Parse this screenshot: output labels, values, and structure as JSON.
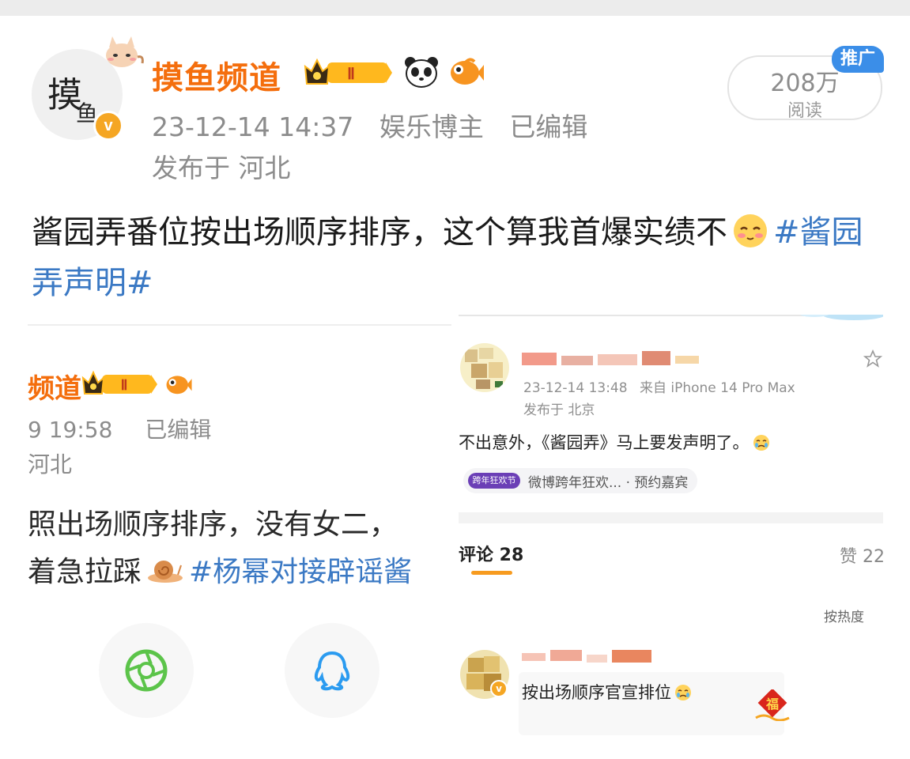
{
  "post": {
    "username": "摸鱼频道",
    "level_badge": "Ⅱ",
    "avatar_calligraphy": "摸",
    "avatar_calligraphy_2": "鱼",
    "verified_mark": "v",
    "timestamp": "23-12-14 14:37",
    "category": "娱乐博主",
    "edited": "已编辑",
    "location": "发布于 河北",
    "read_count": "208万",
    "read_label": "阅读",
    "promo_tag": "推广",
    "text_main": "酱园弄番位按出场顺序排序，这个算我首爆实绩不",
    "emoji": "shy-blush-emoji",
    "hashtag": "#酱园弄声明#"
  },
  "embed_left": {
    "username_partial": "频道",
    "level_badge": "Ⅱ",
    "time_partial": "9 19:58",
    "edited": "已编辑",
    "location_partial": "河北",
    "text_line1": "照出场顺序排序，没有女二，",
    "text_line2_prefix": "着急拉踩",
    "hashtag_partial": "#杨幂对接辟谣酱",
    "share_buttons": [
      "wechat-moments-icon",
      "qq-icon"
    ]
  },
  "embed_right": {
    "timestamp": "23-12-14 13:48",
    "source": "来自 iPhone 14 Pro Max",
    "location": "发布于 北京",
    "text": "不出意外，《酱园弄》马上要发声明了。",
    "event_logo": "跨年狂欢节",
    "event_text": "微博跨年狂欢... · 预约嘉宾",
    "comments_label": "评论 28",
    "likes_label": "赞 22",
    "sort_label": "按热度",
    "comment_badge": "v",
    "comment_text": "按出场顺序官宣排位",
    "fu_char": "福"
  },
  "colors": {
    "username_orange": "#f46e0d",
    "hashtag_blue": "#3b79c4",
    "promo_blue": "#3b8ee8",
    "meta_gray": "#8c8c8c",
    "underline_orange": "#f79b1f"
  }
}
